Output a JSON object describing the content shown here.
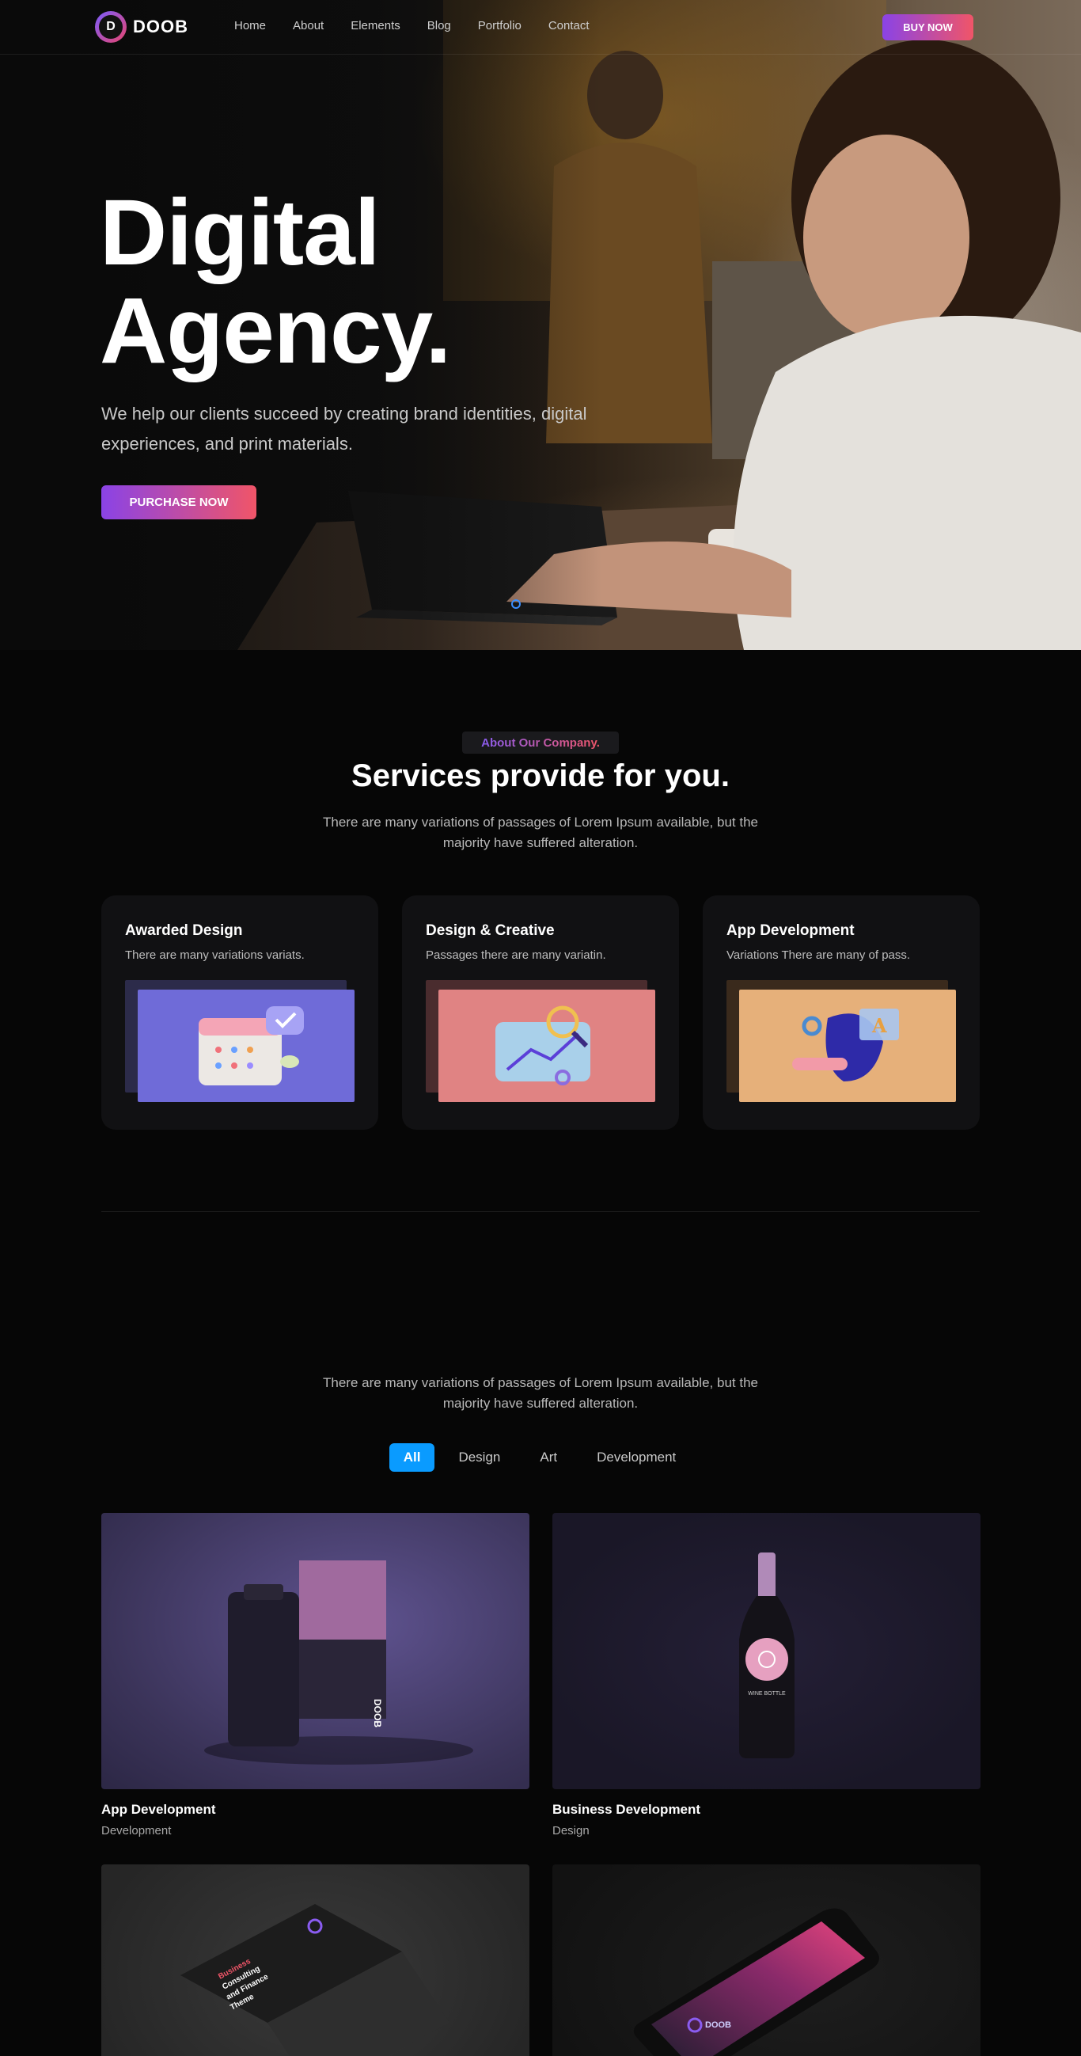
{
  "header": {
    "logo_letter": "D",
    "logo_text": "DOOB",
    "nav": [
      "Home",
      "About",
      "Elements",
      "Blog",
      "Portfolio",
      "Contact"
    ],
    "buy_label": "BUY NOW"
  },
  "hero": {
    "title_line1": "Digital",
    "title_line2": "Agency.",
    "subtitle": "We help our clients succeed by creating brand identities, digital experiences, and print materials.",
    "cta": "PURCHASE NOW"
  },
  "services": {
    "eyebrow": "About Our Company.",
    "title": "Services provide for you.",
    "description": "There are many variations of passages of Lorem Ipsum available, but the majority have suffered alteration.",
    "cards": [
      {
        "title": "Awarded Design",
        "desc": "There are many variations variats."
      },
      {
        "title": "Design & Creative",
        "desc": "Passages there are many variatin."
      },
      {
        "title": "App Development",
        "desc": "Variations There are many of pass."
      }
    ]
  },
  "portfolio": {
    "description": "There are many variations of passages of Lorem Ipsum available, but the majority have suffered alteration.",
    "filters": [
      "All",
      "Design",
      "Art",
      "Development"
    ],
    "items": [
      {
        "title": "App Development",
        "category": "Development"
      },
      {
        "title": "Business Development",
        "category": "Design"
      },
      {
        "title": "",
        "category": ""
      },
      {
        "title": "",
        "category": ""
      }
    ],
    "mock_labels": {
      "box_logo": "DOOB",
      "wine_label": "WINE BOTTLE",
      "brochure_line1": "Business",
      "brochure_line2": "Consulting",
      "brochure_line3": "and Finance",
      "brochure_line4": "Theme",
      "phone_logo": "DOOB"
    }
  },
  "colors": {
    "accent_gradient_start": "#8a43e6",
    "accent_gradient_end": "#f05568",
    "filter_active": "#0a9bff",
    "card1_bg": "#6f6bd8",
    "card2_bg": "#e08383",
    "card3_bg": "#e6b07a"
  }
}
